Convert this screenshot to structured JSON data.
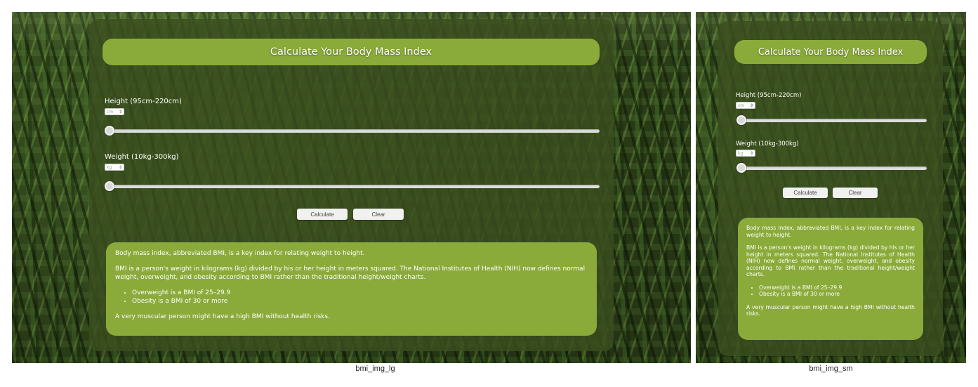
{
  "large": {
    "title": "Calculate Your Body Mass Index",
    "height_label": "Height (95cm-220cm)",
    "height_unit": "cm",
    "weight_label": "Weight (10kg-300kg)",
    "weight_unit": "kg",
    "calculate_label": "Calculate",
    "clear_label": "Clear",
    "info": {
      "p1": "Body mass index, abbreviated BMI, is a key index for relating weight to height.",
      "p2": "BMI is a person's weight in kilograms (kg) divided by his or her height in meters squared. The National Institutes of Health (NIH) now defines normal weight, overweight, and obesity according to BMI rather than the traditional height/weight charts.",
      "bullets": [
        "Overweight is a BMI of 25–29.9",
        "Obesity is a BMI of 30 or more"
      ],
      "p3": "A very muscular person might have a high BMI without health risks."
    },
    "caption": "bmi_img_lg"
  },
  "small": {
    "title": "Calculate Your Body Mass Index",
    "height_label": "Height (95cm-220cm)",
    "height_unit": "cm",
    "weight_label": "Weight (10kg-300kg)",
    "weight_unit": "kg",
    "calculate_label": "Calculate",
    "clear_label": "Clear",
    "info": {
      "p1": "Body mass index, abbreviated BMI, is a key index for relating weight to height.",
      "p2": "BMI is a person's weight in kilograms (kg) divided by his or her height in meters squared. The National Institutes of Health (NIH) now defines normal weight, overweight, and obesity according to BMI rather than the traditional height/weight charts.",
      "bullets": [
        "Overweight is a BMI of 25–29.9",
        "Obesity is a BMI of 30 or more"
      ],
      "p3": "A very muscular person might have a high BMI without health risks."
    },
    "caption": "bmi_img_sm"
  },
  "colors": {
    "accent": "#8aab3a",
    "panel": "#3a4e1e",
    "button": "#f1f1f1"
  },
  "icons": [
    "slider-thumb-icon",
    "select-arrow-icon",
    "bullet-icon"
  ]
}
